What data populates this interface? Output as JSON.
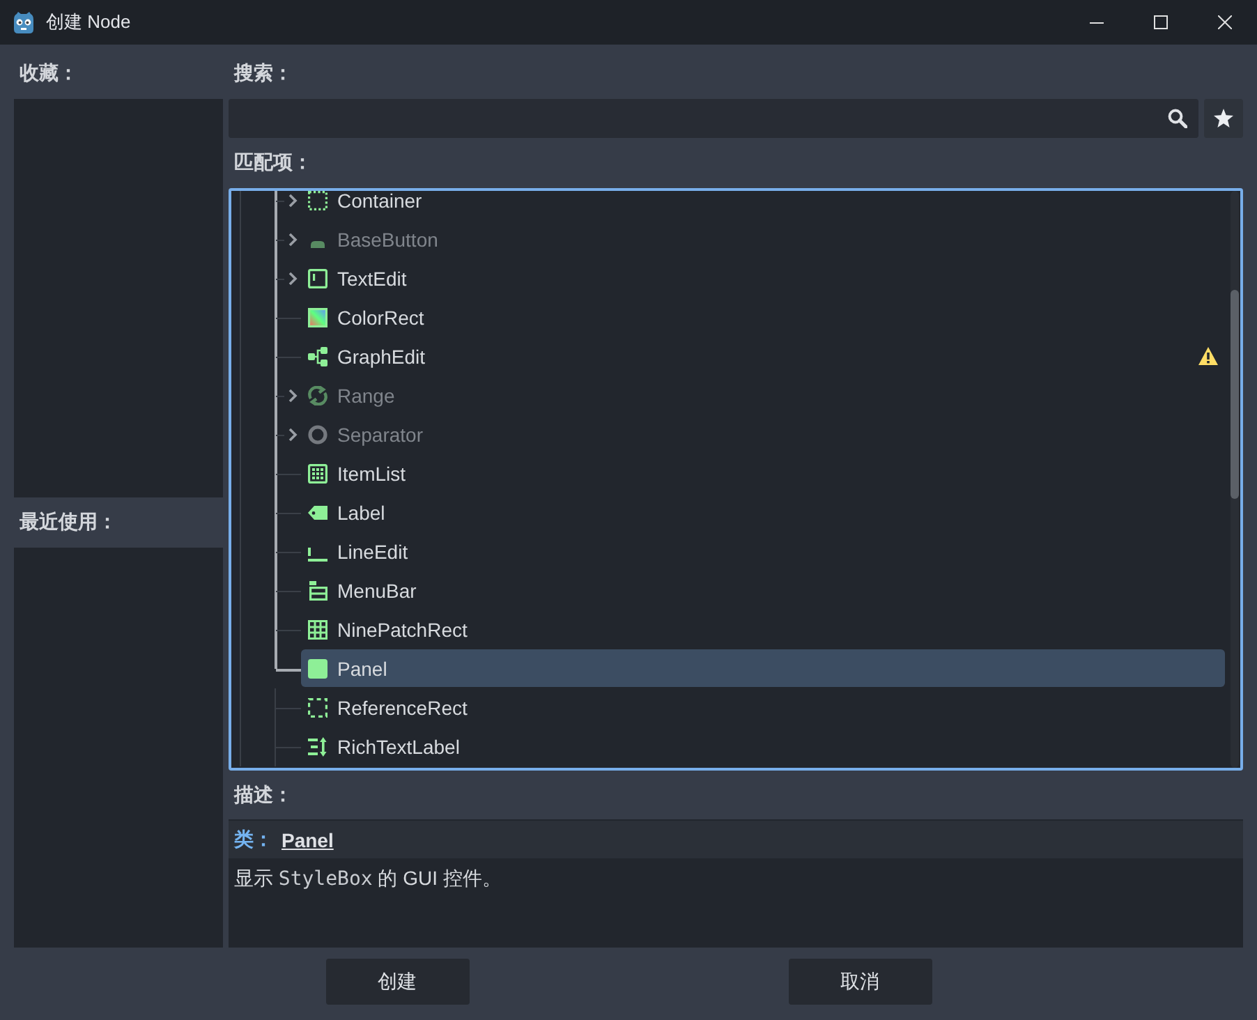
{
  "window": {
    "title": "创建 Node"
  },
  "favorites": {
    "label": "收藏："
  },
  "recent": {
    "label": "最近使用："
  },
  "search": {
    "label": "搜索："
  },
  "matches": {
    "label": "匹配项：",
    "items": [
      {
        "name": "Container",
        "kind": "container",
        "collapsed": true,
        "disabled": false,
        "selected": false,
        "warning": false
      },
      {
        "name": "BaseButton",
        "kind": "basebutton",
        "collapsed": true,
        "disabled": true,
        "selected": false,
        "warning": false
      },
      {
        "name": "TextEdit",
        "kind": "textedit",
        "collapsed": true,
        "disabled": false,
        "selected": false,
        "warning": false
      },
      {
        "name": "ColorRect",
        "kind": "colorrect",
        "collapsed": false,
        "disabled": false,
        "selected": false,
        "warning": false
      },
      {
        "name": "GraphEdit",
        "kind": "graphedit",
        "collapsed": false,
        "disabled": false,
        "selected": false,
        "warning": true
      },
      {
        "name": "Range",
        "kind": "range",
        "collapsed": true,
        "disabled": true,
        "selected": false,
        "warning": false
      },
      {
        "name": "Separator",
        "kind": "separator",
        "collapsed": true,
        "disabled": true,
        "selected": false,
        "warning": false
      },
      {
        "name": "ItemList",
        "kind": "itemlist",
        "collapsed": false,
        "disabled": false,
        "selected": false,
        "warning": false
      },
      {
        "name": "Label",
        "kind": "label",
        "collapsed": false,
        "disabled": false,
        "selected": false,
        "warning": false
      },
      {
        "name": "LineEdit",
        "kind": "lineedit",
        "collapsed": false,
        "disabled": false,
        "selected": false,
        "warning": false
      },
      {
        "name": "MenuBar",
        "kind": "menubar",
        "collapsed": false,
        "disabled": false,
        "selected": false,
        "warning": false
      },
      {
        "name": "NinePatchRect",
        "kind": "ninepatchrect",
        "collapsed": false,
        "disabled": false,
        "selected": false,
        "warning": false
      },
      {
        "name": "Panel",
        "kind": "panel",
        "collapsed": false,
        "disabled": false,
        "selected": true,
        "warning": false
      },
      {
        "name": "ReferenceRect",
        "kind": "referencerect",
        "collapsed": false,
        "disabled": false,
        "selected": false,
        "warning": false
      },
      {
        "name": "RichTextLabel",
        "kind": "richtextlabel",
        "collapsed": false,
        "disabled": false,
        "selected": false,
        "warning": false
      }
    ]
  },
  "description": {
    "label": "描述：",
    "class_label": "类：",
    "class_name": "Panel",
    "text_parts": [
      {
        "kind": "plain",
        "text": "显示 "
      },
      {
        "kind": "code",
        "text": "StyleBox"
      },
      {
        "kind": "plain",
        "text": " 的 GUI 控件。"
      }
    ]
  },
  "buttons": [
    {
      "label": "创建"
    },
    {
      "label": "取消"
    }
  ]
}
